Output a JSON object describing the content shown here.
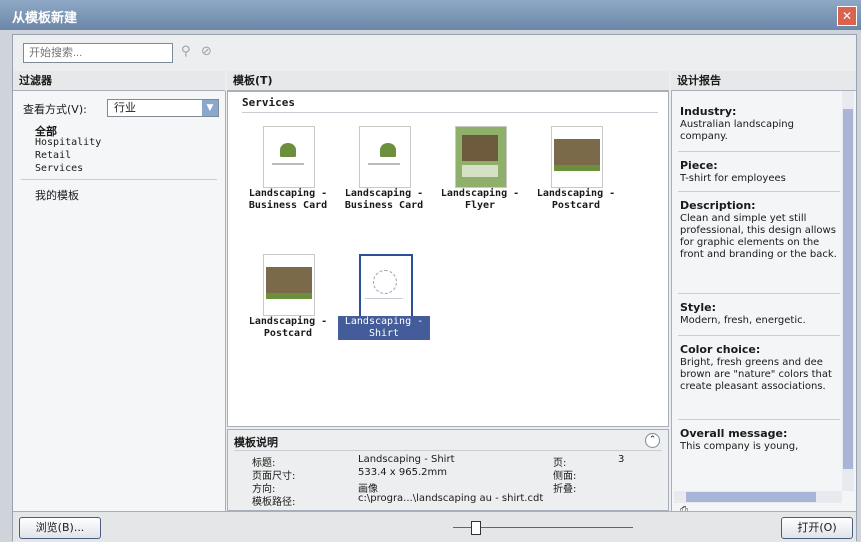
{
  "window": {
    "title": "从模板新建",
    "close_glyph": "✕"
  },
  "search": {
    "placeholder": "开始搜索...",
    "search_icon": "search-icon",
    "clear_icon": "zoom-icon"
  },
  "filter": {
    "header": "过滤器",
    "view_label": "查看方式(V):",
    "view_value": "行业",
    "items": [
      "全部",
      "Hospitality",
      "Retail",
      "Services"
    ],
    "my_templates": "我的模板"
  },
  "templates": {
    "header": "模板(T)",
    "group": "Services",
    "items": [
      {
        "line1": "Landscaping -",
        "line2": "Business Card"
      },
      {
        "line1": "Landscaping -",
        "line2": "Business Card"
      },
      {
        "line1": "Landscaping -",
        "line2": "Flyer"
      },
      {
        "line1": "Landscaping -",
        "line2": "Postcard"
      },
      {
        "line1": "Landscaping -",
        "line2": "Postcard"
      },
      {
        "line1": "Landscaping -",
        "line2": "Shirt"
      }
    ],
    "selected_index": 5
  },
  "details": {
    "header": "模板说明",
    "title_label": "标题:",
    "title_value": "Landscaping - Shirt",
    "page_label": "页:",
    "page_value": "3",
    "size_label": "页面尺寸:",
    "size_value": "533.4 x 965.2mm",
    "side_label": "侧面:",
    "side_value": "",
    "orient_label": "方向:",
    "orient_value": "画像",
    "fold_label": "折叠:",
    "fold_value": "",
    "path_label": "模板路径:",
    "path_value": "c:\\progra...\\landscaping au - shirt.cdt"
  },
  "report": {
    "header": "设计报告",
    "sections": [
      {
        "title": "Industry:",
        "body": "Australian landscaping company."
      },
      {
        "title": "Piece:",
        "body": "T-shirt for employees"
      },
      {
        "title": "Description:",
        "body": "Clean and simple yet still professional, this design allows for graphic elements on the front and branding or the back."
      },
      {
        "title": "Style:",
        "body": "Modern, fresh, energetic."
      },
      {
        "title": "Color choice:",
        "body": "Bright, fresh greens and dee brown are \"nature\" colors that create pleasant associations."
      },
      {
        "title": "Overall message:",
        "body": "This company is young,"
      }
    ]
  },
  "footer": {
    "browse_label": "浏览(B)...",
    "open_label": "打开(O)"
  },
  "colors": {
    "titlebar": "#7a93b4",
    "selection": "#445c99",
    "close": "#d9634f"
  }
}
